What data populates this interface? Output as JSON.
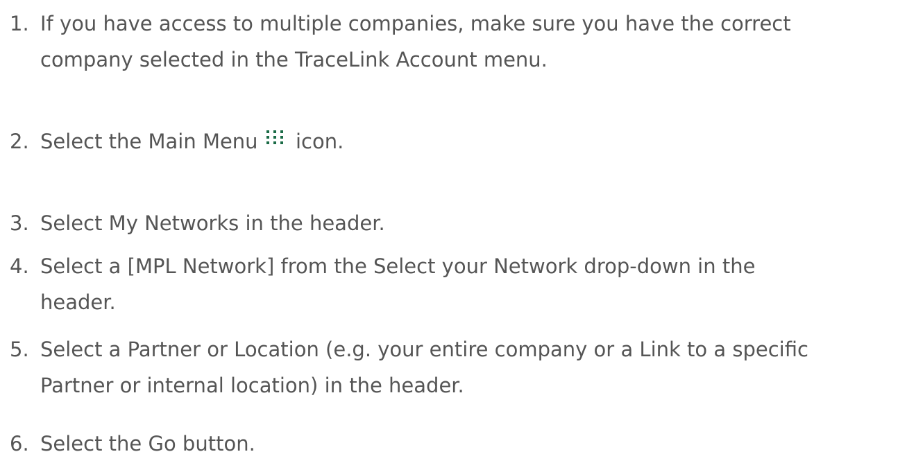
{
  "steps": [
    {
      "number": "1.",
      "line1": "If you have access to multiple companies, make sure you have the correct",
      "line2": "company selected in the TraceLink Account menu."
    },
    {
      "number": "2.",
      "before_icon": "Select the Main Menu",
      "icon": "main-menu-grid-icon",
      "after_icon": "icon."
    },
    {
      "number": "3.",
      "line1": "Select My Networks in the header."
    },
    {
      "number": "4.",
      "line1": "Select a [MPL Network] from the Select your Network drop-down in the",
      "line2": "header."
    },
    {
      "number": "5.",
      "line1": "Select a Partner or Location (e.g. your entire company or a Link to a specific",
      "line2": "Partner or internal location) in the header."
    },
    {
      "number": "6.",
      "line1": "Select the Go button."
    }
  ],
  "colors": {
    "text": "#555555",
    "icon": "#1a6b46"
  }
}
